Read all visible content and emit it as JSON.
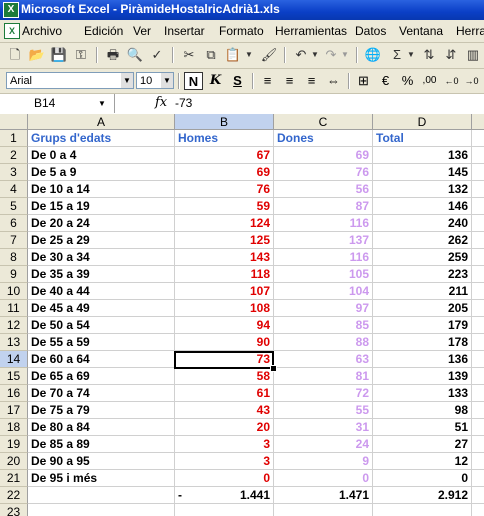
{
  "window": {
    "title": "Microsoft Excel - PiràmideHostalricAdrià1.xls"
  },
  "menu": [
    "Archivo",
    "Edición",
    "Ver",
    "Insertar",
    "Formato",
    "Herramientas",
    "Datos",
    "Ventana",
    "Herra"
  ],
  "format_toolbar": {
    "font": "Arial",
    "size": "10",
    "bold": "N",
    "italic": "K",
    "underline": "S",
    "currency": "€",
    "percent": "%"
  },
  "formula_bar": {
    "name_box": "B14",
    "fx": "fx",
    "value": "-73"
  },
  "columns": [
    "A",
    "B",
    "C",
    "D"
  ],
  "header_row": {
    "row": "1",
    "a": "Grups d'edats",
    "b": "Homes",
    "c": "Dones",
    "d": "Total"
  },
  "rows": [
    {
      "row": "2",
      "a": "De 0 a 4",
      "b": "67",
      "c": "69",
      "d": "136"
    },
    {
      "row": "3",
      "a": "De 5 a 9",
      "b": "69",
      "c": "76",
      "d": "145"
    },
    {
      "row": "4",
      "a": "De 10 a 14",
      "b": "76",
      "c": "56",
      "d": "132"
    },
    {
      "row": "5",
      "a": "De 15 a 19",
      "b": "59",
      "c": "87",
      "d": "146"
    },
    {
      "row": "6",
      "a": "De 20 a 24",
      "b": "124",
      "c": "116",
      "d": "240"
    },
    {
      "row": "7",
      "a": "De 25 a 29",
      "b": "125",
      "c": "137",
      "d": "262"
    },
    {
      "row": "8",
      "a": "De 30 a 34",
      "b": "143",
      "c": "116",
      "d": "259"
    },
    {
      "row": "9",
      "a": "De 35 a 39",
      "b": "118",
      "c": "105",
      "d": "223"
    },
    {
      "row": "10",
      "a": "De 40 a 44",
      "b": "107",
      "c": "104",
      "d": "211"
    },
    {
      "row": "11",
      "a": "De 45 a 49",
      "b": "108",
      "c": "97",
      "d": "205"
    },
    {
      "row": "12",
      "a": "De 50 a 54",
      "b": "94",
      "c": "85",
      "d": "179"
    },
    {
      "row": "13",
      "a": "De 55 a 59",
      "b": "90",
      "c": "88",
      "d": "178"
    },
    {
      "row": "14",
      "a": "De 60 a 64",
      "b": "73",
      "c": "63",
      "d": "136"
    },
    {
      "row": "15",
      "a": "De 65 a 69",
      "b": "58",
      "c": "81",
      "d": "139"
    },
    {
      "row": "16",
      "a": "De 70 a 74",
      "b": "61",
      "c": "72",
      "d": "133"
    },
    {
      "row": "17",
      "a": "De 75 a 79",
      "b": "43",
      "c": "55",
      "d": "98"
    },
    {
      "row": "18",
      "a": "De 80 a 84",
      "b": "20",
      "c": "31",
      "d": "51"
    },
    {
      "row": "19",
      "a": "De 85 a 89",
      "b": "3",
      "c": "24",
      "d": "27"
    },
    {
      "row": "20",
      "a": "De 90 a 95",
      "b": "3",
      "c": "9",
      "d": "12"
    },
    {
      "row": "21",
      "a": "De 95 i més",
      "b": "0",
      "c": "0",
      "d": "0"
    }
  ],
  "total_row": {
    "row": "22",
    "dash": "-",
    "b": "1.441",
    "c": "1.471",
    "d": "2.912"
  },
  "empty_row": {
    "row": "23"
  },
  "active_cell": "B14",
  "colors": {
    "homes": "#e00000",
    "dones": "#cc99ee",
    "header": "#3366cc",
    "titlebar": "#0a3fc6"
  }
}
